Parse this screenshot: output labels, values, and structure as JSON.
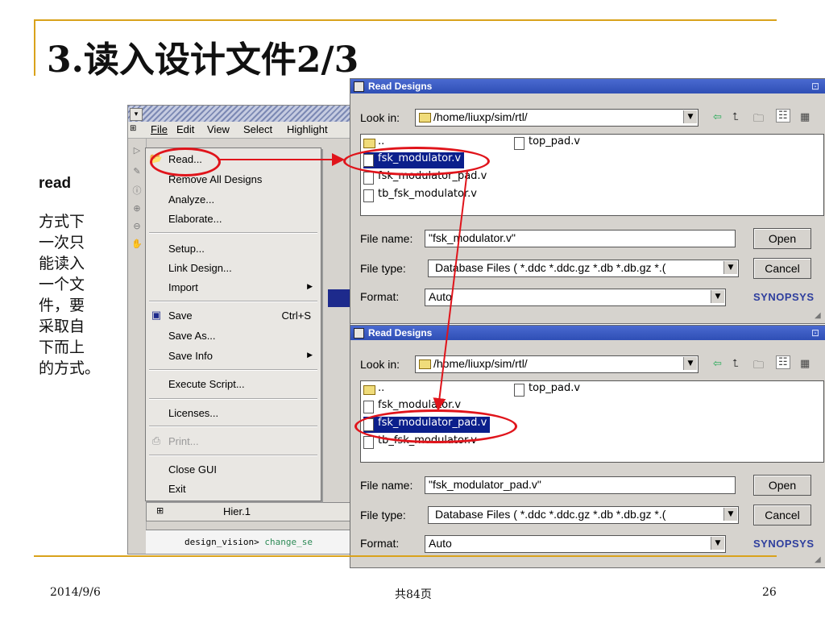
{
  "slide": {
    "title": "3.读入设计文件2/3",
    "side_heading": "read",
    "side_text": [
      "方式下",
      "一次只",
      "能读入",
      "一个文",
      "件，要",
      "采取自",
      "下而上",
      "的方式。"
    ],
    "footer_date": "2014/9/6",
    "footer_pages": "共84页",
    "footer_page_num": "26"
  },
  "design_vision": {
    "menubar": [
      "File",
      "Edit",
      "View",
      "Select",
      "Highlight"
    ],
    "file_menu": {
      "items": [
        {
          "label": "Read...",
          "icon": "open-folder-icon"
        },
        {
          "label": "Remove All Designs"
        },
        {
          "label": "Analyze..."
        },
        {
          "label": "Elaborate..."
        },
        {
          "label": "Setup..."
        },
        {
          "label": "Link Design..."
        },
        {
          "label": "Import",
          "submenu": true
        },
        {
          "label": "Save",
          "accel": "Ctrl+S",
          "icon": "save-disk-icon"
        },
        {
          "label": "Save As..."
        },
        {
          "label": "Save Info",
          "submenu": true
        },
        {
          "label": "Execute Script..."
        },
        {
          "label": "Licenses..."
        },
        {
          "label": "Print...",
          "disabled": true,
          "icon": "printer-icon"
        },
        {
          "label": "Close GUI"
        },
        {
          "label": "Exit"
        }
      ]
    },
    "hier_tab": "Hier.1",
    "console_prompt": "design_vision>",
    "console_cmd": "change_se"
  },
  "dialogs": [
    {
      "title": "Read Designs",
      "look_in_label": "Look in:",
      "look_in_value": "/home/liuxp/sim/rtl/",
      "files_col1": [
        {
          "name": "..",
          "type": "folder"
        },
        {
          "name": "fsk_modulator.v",
          "selected": true
        },
        {
          "name": "fsk_modulator_pad.v"
        },
        {
          "name": "tb_fsk_modulator.v"
        }
      ],
      "files_col2": [
        {
          "name": "top_pad.v"
        }
      ],
      "file_name_label": "File name:",
      "file_name_value": "\"fsk_modulator.v\"",
      "file_type_label": "File type:",
      "file_type_value": "Database Files ( *.ddc *.ddc.gz *.db *.db.gz *.(",
      "format_label": "Format:",
      "format_value": "Auto",
      "open_label": "Open",
      "cancel_label": "Cancel",
      "brand": "SYNOPSYS"
    },
    {
      "title": "Read Designs",
      "look_in_label": "Look in:",
      "look_in_value": "/home/liuxp/sim/rtl/",
      "files_col1": [
        {
          "name": "..",
          "type": "folder"
        },
        {
          "name": "fsk_modulator.v"
        },
        {
          "name": "fsk_modulator_pad.v",
          "selected": true
        },
        {
          "name": "tb_fsk_modulator.v"
        }
      ],
      "files_col2": [
        {
          "name": "top_pad.v"
        }
      ],
      "file_name_label": "File name:",
      "file_name_value": "\"fsk_modulator_pad.v\"",
      "file_type_label": "File type:",
      "file_type_value": "Database Files ( *.ddc *.ddc.gz *.db *.db.gz *.(",
      "format_label": "Format:",
      "format_value": "Auto",
      "open_label": "Open",
      "cancel_label": "Cancel",
      "brand": "SYNOPSYS"
    }
  ],
  "colors": {
    "accent_line": "#d9a21b",
    "annotation_red": "#e0141b",
    "selection_blue": "#0b1f8c"
  }
}
